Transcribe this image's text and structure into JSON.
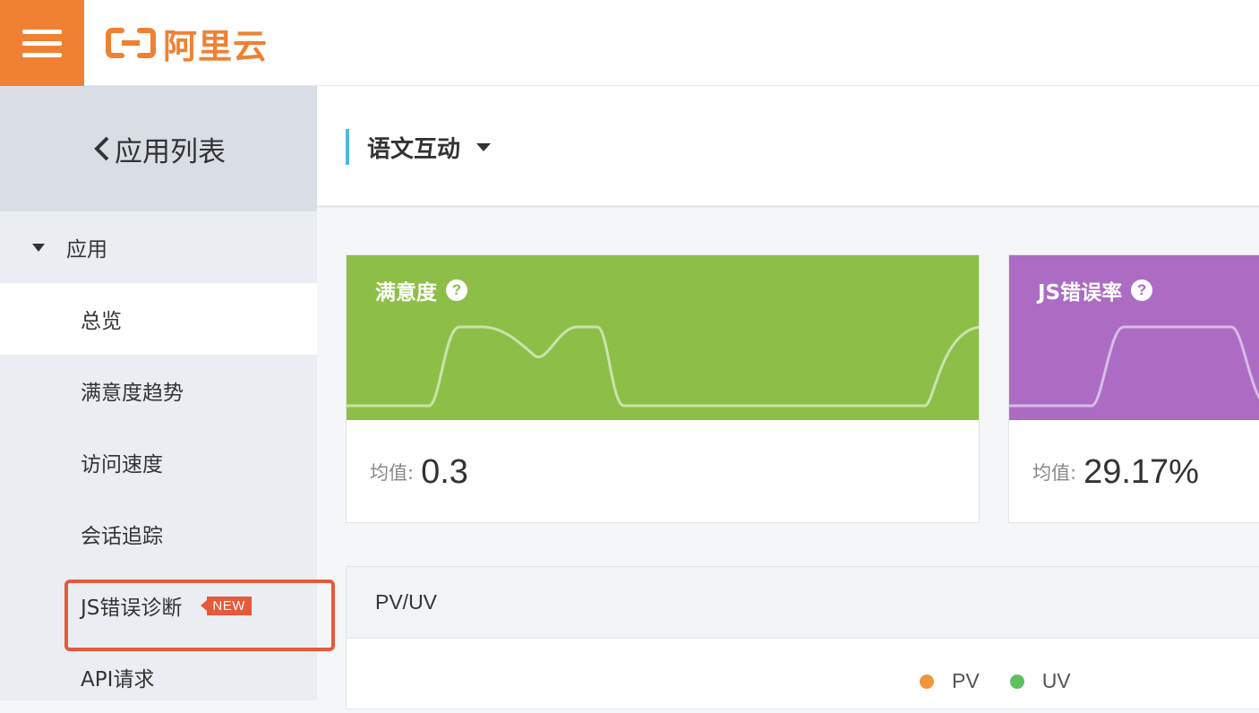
{
  "brand": {
    "name": "阿里云",
    "color": "#f08132",
    "icon": "aliyun-logo"
  },
  "menu": {
    "icon": "hamburger-icon"
  },
  "sidebar": {
    "back_label": "应用列表",
    "group_label": "应用",
    "items": [
      {
        "label": "总览",
        "active": true
      },
      {
        "label": "满意度趋势"
      },
      {
        "label": "访问速度"
      },
      {
        "label": "会话追踪"
      },
      {
        "label": "JS错误诊断",
        "badge": "NEW",
        "highlighted": true
      },
      {
        "label": "API请求"
      }
    ]
  },
  "app_selector": {
    "label": "语文互动"
  },
  "cards": {
    "satisfaction": {
      "title": "满意度",
      "help": "?",
      "avg_label": "均值:",
      "avg_value": "0.3",
      "color": "#8dbf48"
    },
    "js_error": {
      "title": "JS错误率",
      "help": "?",
      "avg_label": "均值:",
      "avg_value": "29.17%",
      "color": "#ac6cc4"
    }
  },
  "pvuv": {
    "title": "PV/UV",
    "legend": [
      {
        "name": "PV",
        "color": "#f0963a"
      },
      {
        "name": "UV",
        "color": "#5cc05c"
      }
    ]
  }
}
